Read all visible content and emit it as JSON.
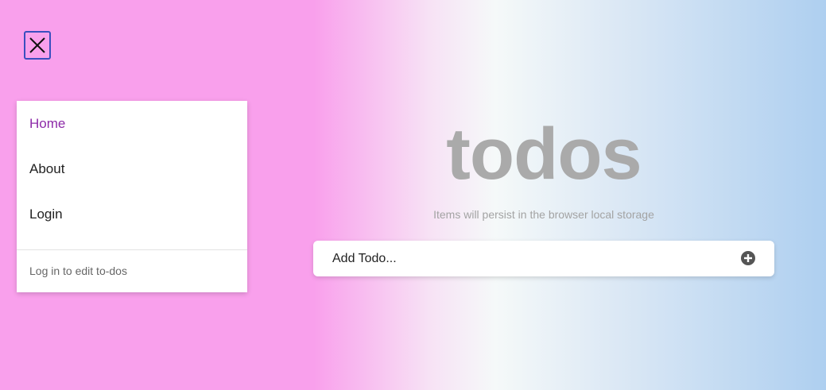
{
  "app": {
    "title": "todos",
    "subtitle": "Items will persist in the browser local storage"
  },
  "nav": {
    "items": [
      {
        "label": "Home",
        "active": true
      },
      {
        "label": "About",
        "active": false
      },
      {
        "label": "Login",
        "active": false
      }
    ],
    "footer": "Log in to edit to-dos"
  },
  "add_todo": {
    "placeholder": "Add Todo...",
    "value": ""
  },
  "icons": {
    "close": "close-icon",
    "add": "plus-circle-icon"
  },
  "colors": {
    "active_nav": "#8d2aa8",
    "title": "#aaaaaa",
    "close_border": "#3a4fbf"
  }
}
